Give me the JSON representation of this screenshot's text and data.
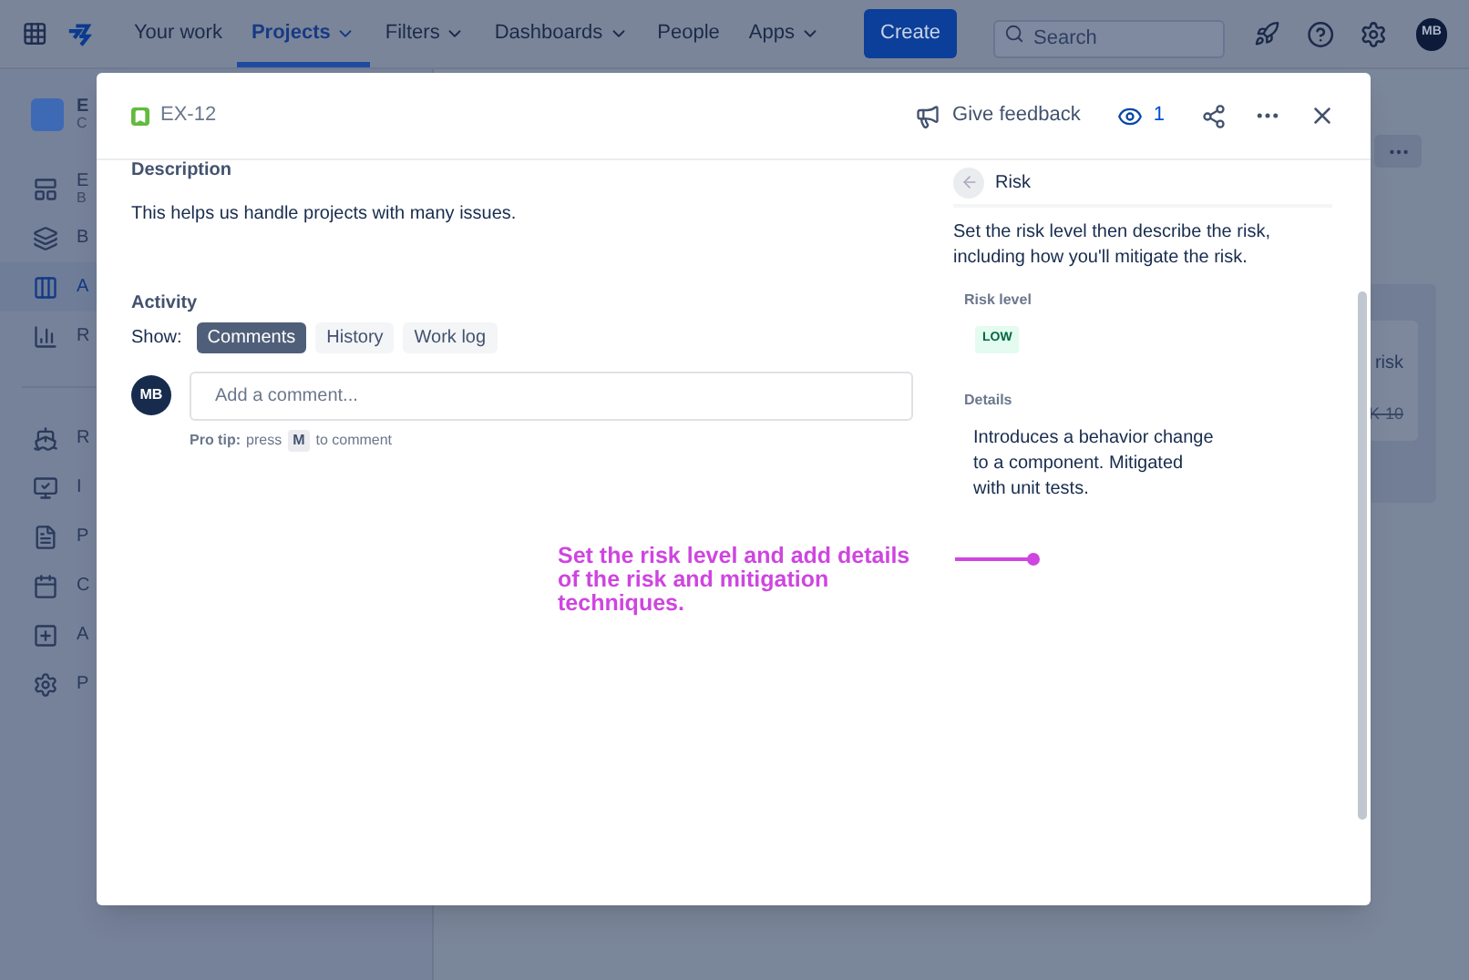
{
  "nav": {
    "items": [
      {
        "label": "Your work",
        "selected": false,
        "dropdown": false
      },
      {
        "label": "Projects",
        "selected": true,
        "dropdown": true
      },
      {
        "label": "Filters",
        "selected": false,
        "dropdown": true
      },
      {
        "label": "Dashboards",
        "selected": false,
        "dropdown": true
      },
      {
        "label": "People",
        "selected": false,
        "dropdown": false
      },
      {
        "label": "Apps",
        "selected": false,
        "dropdown": true
      }
    ],
    "create": "Create",
    "search": {
      "placeholder": "Search"
    },
    "avatar": "MB"
  },
  "sidebar": {
    "project": {
      "name": "E",
      "subtitle": "C"
    },
    "items": [
      {
        "label": "E",
        "sublabel": "B",
        "selected": false
      },
      {
        "label": "B",
        "selected": false
      },
      {
        "label": "A",
        "selected": true
      },
      {
        "label": "R",
        "selected": false
      }
    ],
    "items_2": [
      {
        "label": "R"
      },
      {
        "label": "I"
      },
      {
        "label": "P"
      },
      {
        "label": "C"
      },
      {
        "label": "A"
      },
      {
        "label": "P"
      }
    ]
  },
  "background_card": {
    "text": "risk",
    "key": "K-10",
    "strikethrough": true
  },
  "modal": {
    "issue_key": "EX-12",
    "give_feedback": "Give feedback",
    "watchers": "1",
    "description": {
      "heading": "Description",
      "text": "This helps us handle projects with many issues."
    },
    "activity": {
      "heading": "Activity",
      "show_label": "Show:",
      "tabs": [
        {
          "label": "Comments",
          "selected": true
        },
        {
          "label": "History",
          "selected": false
        },
        {
          "label": "Work log",
          "selected": false
        }
      ],
      "avatar": "MB",
      "comment": {
        "placeholder": "Add a comment..."
      },
      "pro_tip": {
        "label": "Pro tip:",
        "before": "press",
        "key": "M",
        "after": "to comment"
      }
    },
    "risk_panel": {
      "title": "Risk",
      "intro": "Set the risk level then describe the risk, including how you'll mitigate the risk.",
      "risk_level_label": "Risk level",
      "risk_level": "LOW",
      "details_label": "Details",
      "details": "Introduces a behavior change to a component. Mitigated with unit tests."
    },
    "annotation": "Set the risk level and add details of the risk and mitigation techniques."
  }
}
